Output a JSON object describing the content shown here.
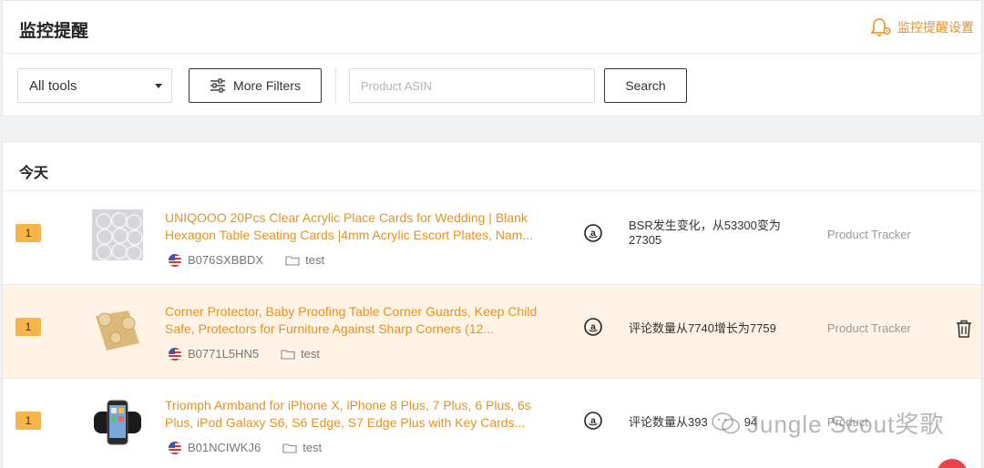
{
  "header": {
    "title": "监控提醒",
    "settings_label": "监控提醒设置",
    "accent_color": "#e8911e"
  },
  "filters": {
    "tool_select": "All tools",
    "more_filters_label": "More Filters",
    "asin_placeholder": "Product ASIN",
    "search_label": "Search"
  },
  "section": {
    "title": "今天"
  },
  "alerts": [
    {
      "count": "1",
      "title": "UNIQOOO 20Pcs Clear Acrylic Place Cards for Wedding | Blank Hexagon Table Seating Cards |4mm Acrylic Escort Plates, Nam...",
      "marketplace": "us-flag-icon",
      "asin": "B076SXBBDX",
      "folder": "test",
      "change": "BSR发生变化，从53300变为27305",
      "tool": "Product Tracker"
    },
    {
      "count": "1",
      "title": "Corner Protector, Baby Proofing Table Corner Guards, Keep Child Safe, Protectors for Furniture Against Sharp Corners (12...",
      "marketplace": "us-flag-icon",
      "asin": "B0771L5HN5",
      "folder": "test",
      "change": "评论数量从7740增长为7759",
      "tool": "Product Tracker"
    },
    {
      "count": "1",
      "title": "Triomph Armband for iPhone X, iPhone 8 Plus, 7 Plus, 6 Plus, 6s Plus, iPod Galaxy S6, S6 Edge, S7 Edge Plus with Key Cards...",
      "marketplace": "us-flag-icon",
      "asin": "B01NCIWKJ6",
      "folder": "test",
      "change": "评论数量从393",
      "change_tail": "94",
      "tool": "Product"
    }
  ],
  "watermark": "Jungle Scout奖歌"
}
